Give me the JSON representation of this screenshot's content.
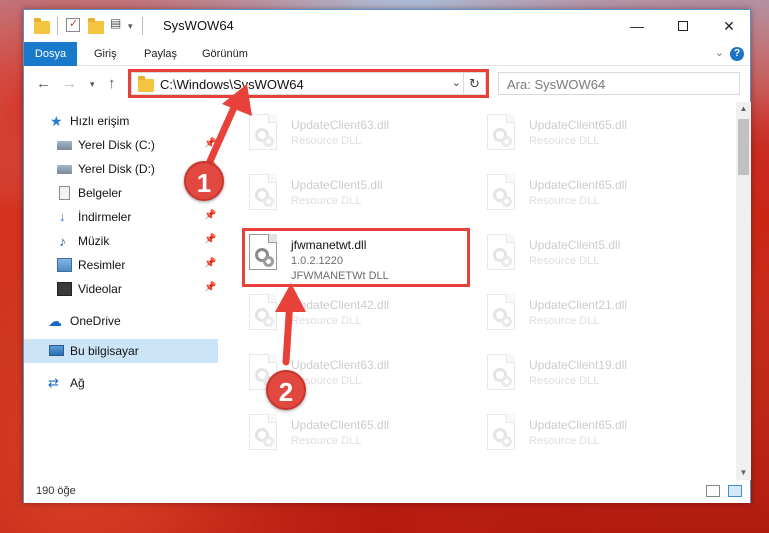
{
  "window": {
    "title": "SysWOW64"
  },
  "ribbon": {
    "tabs": [
      "Dosya",
      "Giriş",
      "Paylaş",
      "Görünüm"
    ]
  },
  "address": {
    "path": "C:\\Windows\\SysWOW64"
  },
  "search": {
    "placeholder": "Ara: SysWOW64"
  },
  "sidebar": {
    "items": [
      {
        "label": "Hızlı erişim",
        "icon": "star-icon"
      },
      {
        "label": "Yerel Disk (C:)",
        "icon": "drive-icon"
      },
      {
        "label": "Yerel Disk (D:)",
        "icon": "drive-icon"
      },
      {
        "label": "Belgeler",
        "icon": "document-icon"
      },
      {
        "label": "İndirmeler",
        "icon": "download-icon"
      },
      {
        "label": "Müzik",
        "icon": "music-icon"
      },
      {
        "label": "Resimler",
        "icon": "picture-icon"
      },
      {
        "label": "Videolar",
        "icon": "video-icon"
      },
      {
        "label": "OneDrive",
        "icon": "cloud-icon"
      },
      {
        "label": "Bu bilgisayar",
        "icon": "computer-icon"
      },
      {
        "label": "Ağ",
        "icon": "network-icon"
      }
    ]
  },
  "files": {
    "left": [
      {
        "name": "UpdateClient63.dll",
        "type": "Resource DLL"
      },
      {
        "name": "UpdateClient5.dll",
        "type": "Resource DLL"
      },
      {
        "name": "UpdateClient42.dll",
        "type": "Resource DLL"
      },
      {
        "name": "UpdateClient63.dll",
        "type": "Resource DLL"
      },
      {
        "name": "UpdateClient65.dll",
        "type": "Resource DLL"
      }
    ],
    "right": [
      {
        "name": "UpdateClient65.dll",
        "type": "Resource DLL"
      },
      {
        "name": "UpdateClient65.dll",
        "type": "Resource DLL"
      },
      {
        "name": "UpdateClient5.dll",
        "type": "Resource DLL"
      },
      {
        "name": "UpdateClient21.dll",
        "type": "Resource DLL"
      },
      {
        "name": "UpdateClient19.dll",
        "type": "Resource DLL"
      },
      {
        "name": "UpdateClient65.dll",
        "type": "Resource DLL"
      }
    ],
    "selected": {
      "name": "jfwmanetwt.dll",
      "version": "1.0.2.1220",
      "description": "JFWMANETWt DLL"
    }
  },
  "status": {
    "count": "190 öğe"
  },
  "annotations": {
    "step1": "1",
    "step2": "2",
    "color": "#e8413a"
  }
}
